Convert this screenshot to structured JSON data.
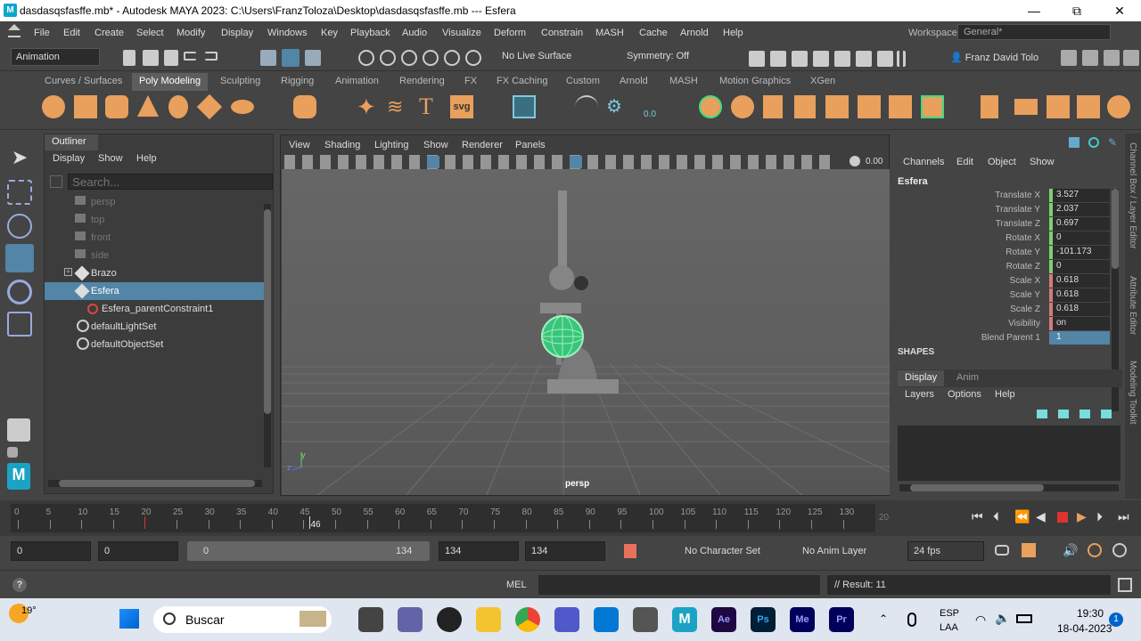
{
  "title_bar": {
    "app_badge": "M",
    "text": "dasdasqsfasffe.mb* - Autodesk MAYA 2023: C:\\Users\\FranzToloza\\Desktop\\dasdasqsfasffe.mb   ---   Esfera",
    "min": "—",
    "max": "⧉",
    "close": "✕"
  },
  "menu": [
    "File",
    "Edit",
    "Create",
    "Select",
    "Modify",
    "Display",
    "Windows",
    "Key",
    "Playback",
    "Audio",
    "Visualize",
    "Deform",
    "Constrain",
    "MASH",
    "Cache",
    "Arnold",
    "Help"
  ],
  "workspace": {
    "label": "Workspace:",
    "value": "General*"
  },
  "status": {
    "mode": "Animation",
    "live_surface": "No Live Surface",
    "symmetry": "Symmetry: Off",
    "user": "Franz David Tolo"
  },
  "shelf_tabs": [
    "Curves / Surfaces",
    "Poly Modeling",
    "Sculpting",
    "Rigging",
    "Animation",
    "Rendering",
    "FX",
    "FX Caching",
    "Custom",
    "Arnold",
    "MASH",
    "Motion Graphics",
    "XGen"
  ],
  "shelf_active": "Poly Modeling",
  "shelf_text_icons": {
    "text": "T",
    "svg": "svg",
    "num": "0.0"
  },
  "outliner": {
    "title": "Outliner",
    "menu": [
      "Display",
      "Show",
      "Help"
    ],
    "search_placeholder": "Search...",
    "items": [
      {
        "label": "persp",
        "dim": true
      },
      {
        "label": "top",
        "dim": true
      },
      {
        "label": "front",
        "dim": true
      },
      {
        "label": "side",
        "dim": true
      },
      {
        "label": "Brazo"
      },
      {
        "label": "Esfera",
        "selected": true
      },
      {
        "label": "Esfera_parentConstraint1"
      },
      {
        "label": "defaultLightSet"
      },
      {
        "label": "defaultObjectSet"
      }
    ]
  },
  "viewport": {
    "menu": [
      "View",
      "Shading",
      "Lighting",
      "Show",
      "Renderer",
      "Panels"
    ],
    "exposure": "0.00",
    "camera": "persp",
    "axis_y": "y",
    "axis_z": "z"
  },
  "channel_box": {
    "menu": [
      "Channels",
      "Edit",
      "Object",
      "Show"
    ],
    "object": "Esfera",
    "rows": [
      {
        "label": "Translate X",
        "value": "3.527",
        "c": "green"
      },
      {
        "label": "Translate Y",
        "value": "2.037",
        "c": "green"
      },
      {
        "label": "Translate Z",
        "value": "0.697",
        "c": "green"
      },
      {
        "label": "Rotate X",
        "value": "0",
        "c": "green"
      },
      {
        "label": "Rotate Y",
        "value": "-101.173",
        "c": "green"
      },
      {
        "label": "Rotate Z",
        "value": "0",
        "c": "green"
      },
      {
        "label": "Scale X",
        "value": "0.618",
        "c": "red"
      },
      {
        "label": "Scale Y",
        "value": "0.618",
        "c": "red"
      },
      {
        "label": "Scale Z",
        "value": "0.618",
        "c": "red"
      },
      {
        "label": "Visibility",
        "value": "on",
        "c": "red"
      },
      {
        "label": "Blend Parent 1",
        "value": "1",
        "c": "blue"
      }
    ],
    "shapes": "SHAPES",
    "layer_tabs": [
      "Display",
      "Anim"
    ],
    "layer_menu": [
      "Layers",
      "Options",
      "Help"
    ]
  },
  "side_tabs": [
    "Channel Box / Layer Editor",
    "Attribute Editor",
    "Modeling Toolkit"
  ],
  "timeline": {
    "ticks": [
      "0",
      "5",
      "10",
      "15",
      "20",
      "25",
      "30",
      "35",
      "40",
      "45",
      "50",
      "55",
      "60",
      "65",
      "70",
      "75",
      "80",
      "85",
      "90",
      "95",
      "100",
      "105",
      "110",
      "115",
      "120",
      "125",
      "130"
    ],
    "current": "46",
    "end_label": "20"
  },
  "range": {
    "start": "0",
    "anim_start": "0",
    "slider_start": "0",
    "slider_end": "134",
    "end": "134",
    "anim_end": "134",
    "character_set": "No Character Set",
    "anim_layer": "No Anim Layer",
    "fps": "24 fps"
  },
  "command": {
    "lang": "MEL",
    "result": "// Result: 11"
  },
  "taskbar": {
    "weather": "19°",
    "search": "Buscar",
    "lang1": "ESP",
    "lang2": "LAA",
    "time": "19:30",
    "date": "18-04-2023",
    "badge": "1"
  },
  "colors": {
    "accent": "#5285a6",
    "shelf_orange": "#e8a05c",
    "sphere": "#3ddc84"
  }
}
